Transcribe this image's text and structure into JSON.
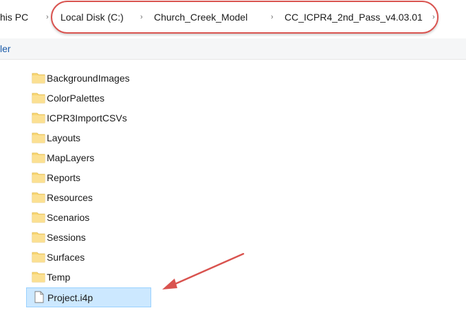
{
  "breadcrumb": {
    "items": [
      "his PC",
      "Local Disk (C:)",
      "Church_Creek_Model",
      "CC_ICPR4_2nd_Pass_v4.03.01"
    ],
    "separator": "›"
  },
  "toolbar": {
    "label": "ler"
  },
  "files": [
    {
      "name": "BackgroundImages",
      "type": "folder"
    },
    {
      "name": "ColorPalettes",
      "type": "folder"
    },
    {
      "name": "ICPR3ImportCSVs",
      "type": "folder"
    },
    {
      "name": "Layouts",
      "type": "folder"
    },
    {
      "name": "MapLayers",
      "type": "folder"
    },
    {
      "name": "Reports",
      "type": "folder"
    },
    {
      "name": "Resources",
      "type": "folder"
    },
    {
      "name": "Scenarios",
      "type": "folder"
    },
    {
      "name": "Sessions",
      "type": "folder"
    },
    {
      "name": "Surfaces",
      "type": "folder"
    },
    {
      "name": "Temp",
      "type": "folder"
    },
    {
      "name": "Project.i4p",
      "type": "file",
      "selected": true
    }
  ],
  "colors": {
    "annotation_red": "#d9534f",
    "folder_yellow": "#f8d775",
    "selection_blue": "#cce8ff"
  }
}
